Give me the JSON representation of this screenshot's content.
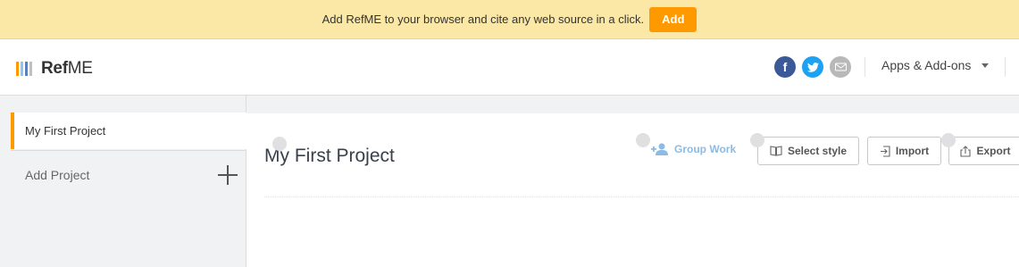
{
  "banner": {
    "text": "Add RefME to your browser and cite any web source in a click.",
    "button_label": "Add",
    "bg_color": "#fbe8a6",
    "button_color": "#ff9900"
  },
  "header": {
    "logo": {
      "bold": "Ref",
      "rest": "ME",
      "mark_colors": [
        "#ff9900",
        "#8ec5ee",
        "#5a7fbf",
        "#c0c0c0"
      ]
    },
    "social": [
      {
        "name": "facebook-icon",
        "glyph": "f",
        "color": "#3b5998"
      },
      {
        "name": "twitter-icon",
        "glyph": "t",
        "color": "#1da1f2"
      },
      {
        "name": "mail-icon",
        "glyph": "✉",
        "color": "#b8b8b8"
      }
    ],
    "apps_label": "Apps & Add-ons"
  },
  "sidebar": {
    "active_project": "My First Project",
    "add_project_label": "Add Project",
    "accent_color": "#ff9900"
  },
  "project": {
    "title": "My First Project",
    "group_work_label": "Group Work",
    "select_style_label": "Select style",
    "import_label": "Import",
    "export_label": "Export"
  }
}
